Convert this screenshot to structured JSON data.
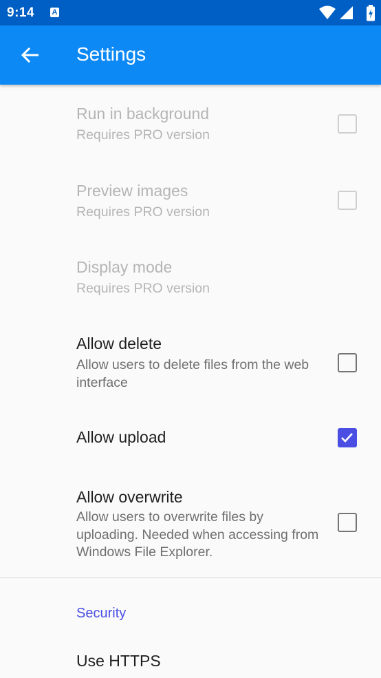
{
  "status_bar": {
    "time": "9:14",
    "notification_icon": "a-notification-icon",
    "wifi_icon": "wifi-icon",
    "signal_icon": "signal-icon",
    "battery_icon": "battery-charging-icon"
  },
  "app_bar": {
    "title": "Settings",
    "back_icon": "arrow-back-icon",
    "background_color": "#0c89f5"
  },
  "preferences": [
    {
      "title": "Run in background",
      "summary": "Requires PRO version",
      "enabled": false,
      "checked": false,
      "has_checkbox": true
    },
    {
      "title": "Preview images",
      "summary": "Requires PRO version",
      "enabled": false,
      "checked": false,
      "has_checkbox": true
    },
    {
      "title": "Display mode",
      "summary": "Requires PRO version",
      "enabled": false,
      "has_checkbox": false
    },
    {
      "title": "Allow delete",
      "summary": "Allow users to delete files from the web interface",
      "enabled": true,
      "checked": false,
      "has_checkbox": true
    },
    {
      "title": "Allow upload",
      "summary": "",
      "enabled": true,
      "checked": true,
      "has_checkbox": true
    },
    {
      "title": "Allow overwrite",
      "summary": "Allow users to overwrite files by uploading. Needed when accessing from Windows File Explorer.",
      "enabled": true,
      "checked": false,
      "has_checkbox": true
    }
  ],
  "security_section": {
    "header": "Security",
    "items": [
      {
        "title": "Use HTTPS"
      }
    ]
  },
  "accent_color": "#4a4ee3"
}
